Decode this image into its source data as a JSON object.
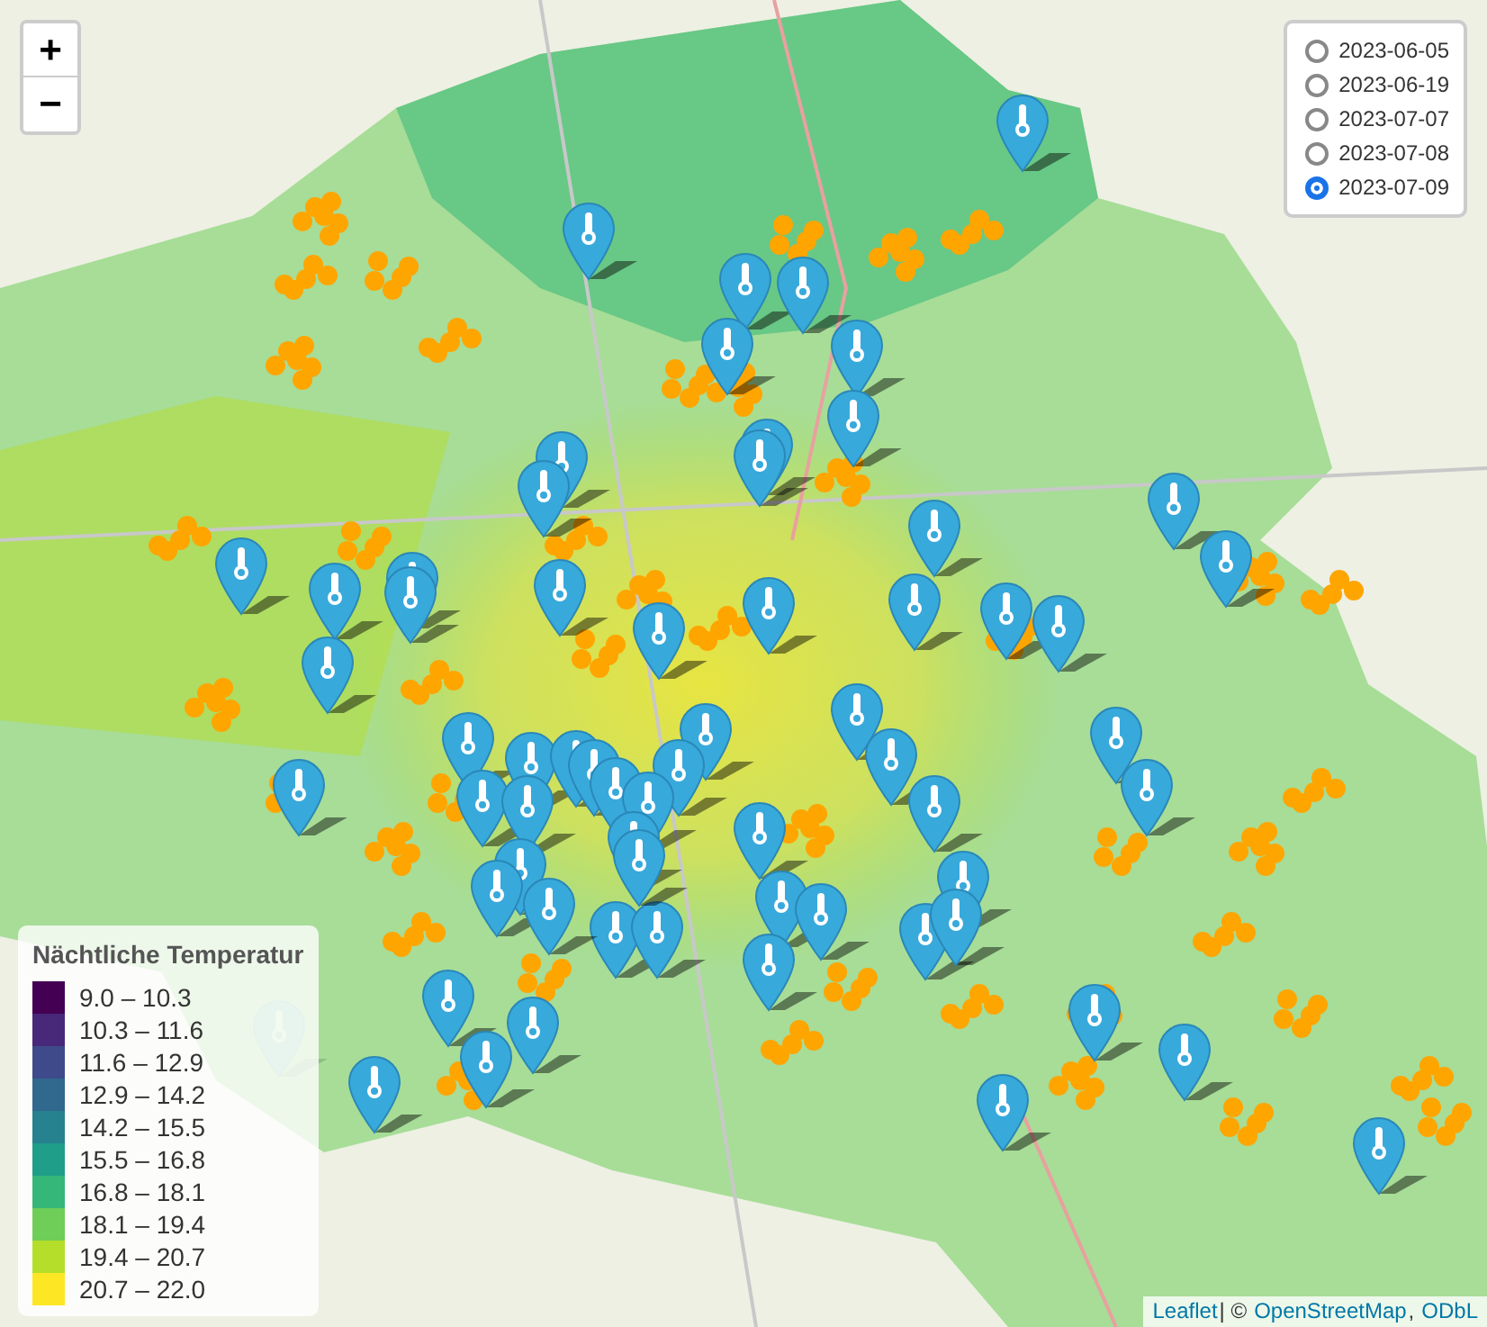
{
  "zoom_control": {
    "zoom_in": "+",
    "zoom_out": "−"
  },
  "layers": [
    {
      "label": "2023-06-05",
      "selected": false
    },
    {
      "label": "2023-06-19",
      "selected": false
    },
    {
      "label": "2023-07-07",
      "selected": false
    },
    {
      "label": "2023-07-08",
      "selected": false
    },
    {
      "label": "2023-07-09",
      "selected": true
    }
  ],
  "legend": {
    "title": "Nächtliche Temperatur",
    "items": [
      {
        "label": "9.0 – 10.3",
        "color": "#440154"
      },
      {
        "label": "10.3 – 11.6",
        "color": "#482878"
      },
      {
        "label": "11.6 – 12.9",
        "color": "#3e4a89"
      },
      {
        "label": "12.9 – 14.2",
        "color": "#31688e"
      },
      {
        "label": "14.2 – 15.5",
        "color": "#26828e"
      },
      {
        "label": "15.5 – 16.8",
        "color": "#1f9e89"
      },
      {
        "label": "16.8 – 18.1",
        "color": "#35b779"
      },
      {
        "label": "18.1 – 19.4",
        "color": "#6ece58"
      },
      {
        "label": "19.4 – 20.7",
        "color": "#b5de2b"
      },
      {
        "label": "20.7 – 22.0",
        "color": "#fde725"
      }
    ]
  },
  "attribution": [
    {
      "kind": "link",
      "text": "Leaflet"
    },
    {
      "kind": "text",
      "text": "| ©"
    },
    {
      "kind": "link",
      "text": "OpenStreetMap"
    },
    {
      "kind": "text",
      "text": ","
    },
    {
      "kind": "link",
      "text": "ODbL"
    }
  ]
}
